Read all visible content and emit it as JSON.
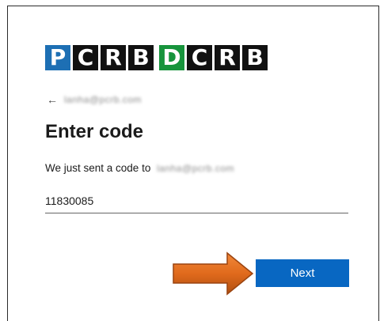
{
  "logo": {
    "group1": [
      "P",
      "C",
      "R",
      "B"
    ],
    "group2": [
      "D",
      "C",
      "R",
      "B"
    ],
    "accent_blue": "#1d6fb4",
    "accent_green": "#17943c"
  },
  "back": {
    "icon": "back-arrow-icon",
    "glyph": "←",
    "email": "lanha@pcrb.com"
  },
  "title": "Enter code",
  "sent_message": {
    "prefix": "We just sent a code to",
    "email": "lanha@pcrb.com"
  },
  "code_field": {
    "value": "11830085"
  },
  "next_button": {
    "label": "Next",
    "color": "#0867c2"
  },
  "annotation": {
    "icon": "orange-arrow-icon",
    "color": "#e06a1c"
  }
}
